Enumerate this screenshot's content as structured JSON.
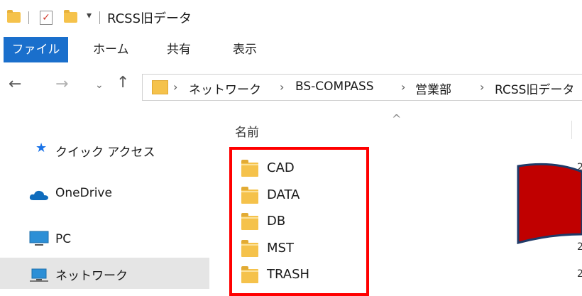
{
  "window": {
    "title": "RCSS旧データ"
  },
  "quick_access_toolbar": {
    "icons": [
      "folder-icon",
      "properties-check-icon",
      "new-folder-icon",
      "customize-dropdown-icon"
    ]
  },
  "ribbon": {
    "tabs": [
      {
        "label": "ファイル",
        "active": true
      },
      {
        "label": "ホーム"
      },
      {
        "label": "共有"
      },
      {
        "label": "表示"
      }
    ],
    "active_color": "#1a6fcc"
  },
  "address_bar": {
    "crumbs": [
      "ネットワーク",
      "BS-COMPASS",
      "営業部",
      "RCSS旧データ"
    ]
  },
  "nav_pane": {
    "items": [
      {
        "label": "クイック アクセス",
        "icon": "star-icon"
      },
      {
        "label": "OneDrive",
        "icon": "cloud-icon"
      },
      {
        "label": "PC",
        "icon": "monitor-icon"
      },
      {
        "label": "ネットワーク",
        "icon": "network-icon",
        "selected": true
      }
    ]
  },
  "file_list": {
    "column_name": "名前",
    "sort_indicator": "^",
    "files": [
      "CAD",
      "DATA",
      "DB",
      "MST",
      "TRASH"
    ]
  },
  "annotations": {
    "highlight_color": "#ff0000",
    "arrow_color": "#c00000"
  }
}
